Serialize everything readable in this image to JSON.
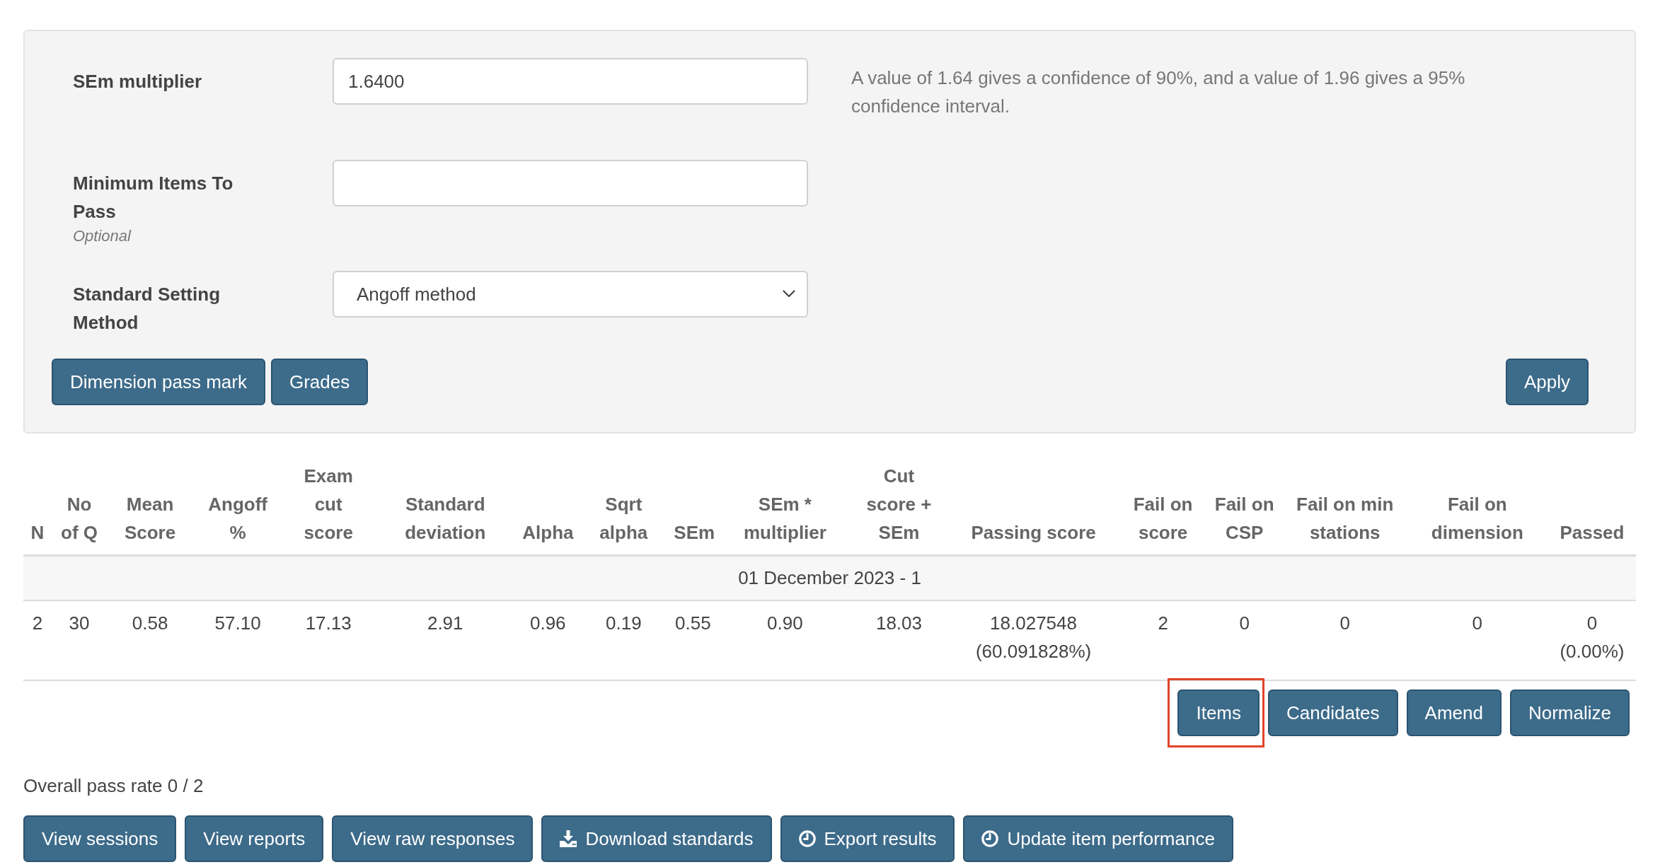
{
  "settings_panel": {
    "fields": [
      {
        "kind": "input",
        "label": "SEm multiplier",
        "value": "1.6400",
        "help": "A value of 1.64 gives a confidence of 90%, and a value of 1.96 gives a 95% confidence interval."
      },
      {
        "kind": "input",
        "label": "Minimum Items To Pass",
        "note": "Optional"
      },
      {
        "kind": "select",
        "label": "Standard Setting Method",
        "value": "Angoff method"
      }
    ],
    "buttons": [
      "Dimension pass mark",
      "Grades"
    ],
    "apply_button": "Apply"
  },
  "results_table": {
    "columns": [
      "N",
      "No of Q",
      "Mean Score",
      "Angoff %",
      "Exam cut score",
      "Standard deviation",
      "Alpha",
      "Sqrt alpha",
      "SEm",
      "SEm * multiplier",
      "Cut score + SEm",
      "Passing score",
      "Fail on score",
      "Fail on CSP",
      "Fail on min stations",
      "Fail on dimension",
      "Passed"
    ],
    "groups": [
      {
        "title": "01 December 2023 - 1",
        "rows": [
          [
            "2",
            "30",
            "0.58",
            "57.10",
            "17.13",
            "2.91",
            "0.96",
            "0.19",
            "0.55",
            "0.90",
            "18.03",
            "18.027548 (60.091828%)",
            "2",
            "0",
            "0",
            "0",
            "0 (0.00%)"
          ]
        ]
      }
    ]
  },
  "row_actions": [
    {
      "label": "Items",
      "highlighted": true
    },
    {
      "label": "Candidates",
      "highlighted": false
    },
    {
      "label": "Amend",
      "highlighted": false
    },
    {
      "label": "Normalize",
      "highlighted": false
    }
  ],
  "overall_pass_rate": "Overall pass rate 0 / 2",
  "footer_buttons": [
    {
      "label": "View sessions",
      "kind": "plain"
    },
    {
      "label": "View reports",
      "kind": "plain"
    },
    {
      "label": "View raw responses",
      "kind": "plain"
    },
    {
      "label": "Download standards",
      "kind": "download"
    },
    {
      "label": "Export results",
      "kind": "scheduled"
    },
    {
      "label": "Update item performance",
      "kind": "scheduled"
    }
  ]
}
